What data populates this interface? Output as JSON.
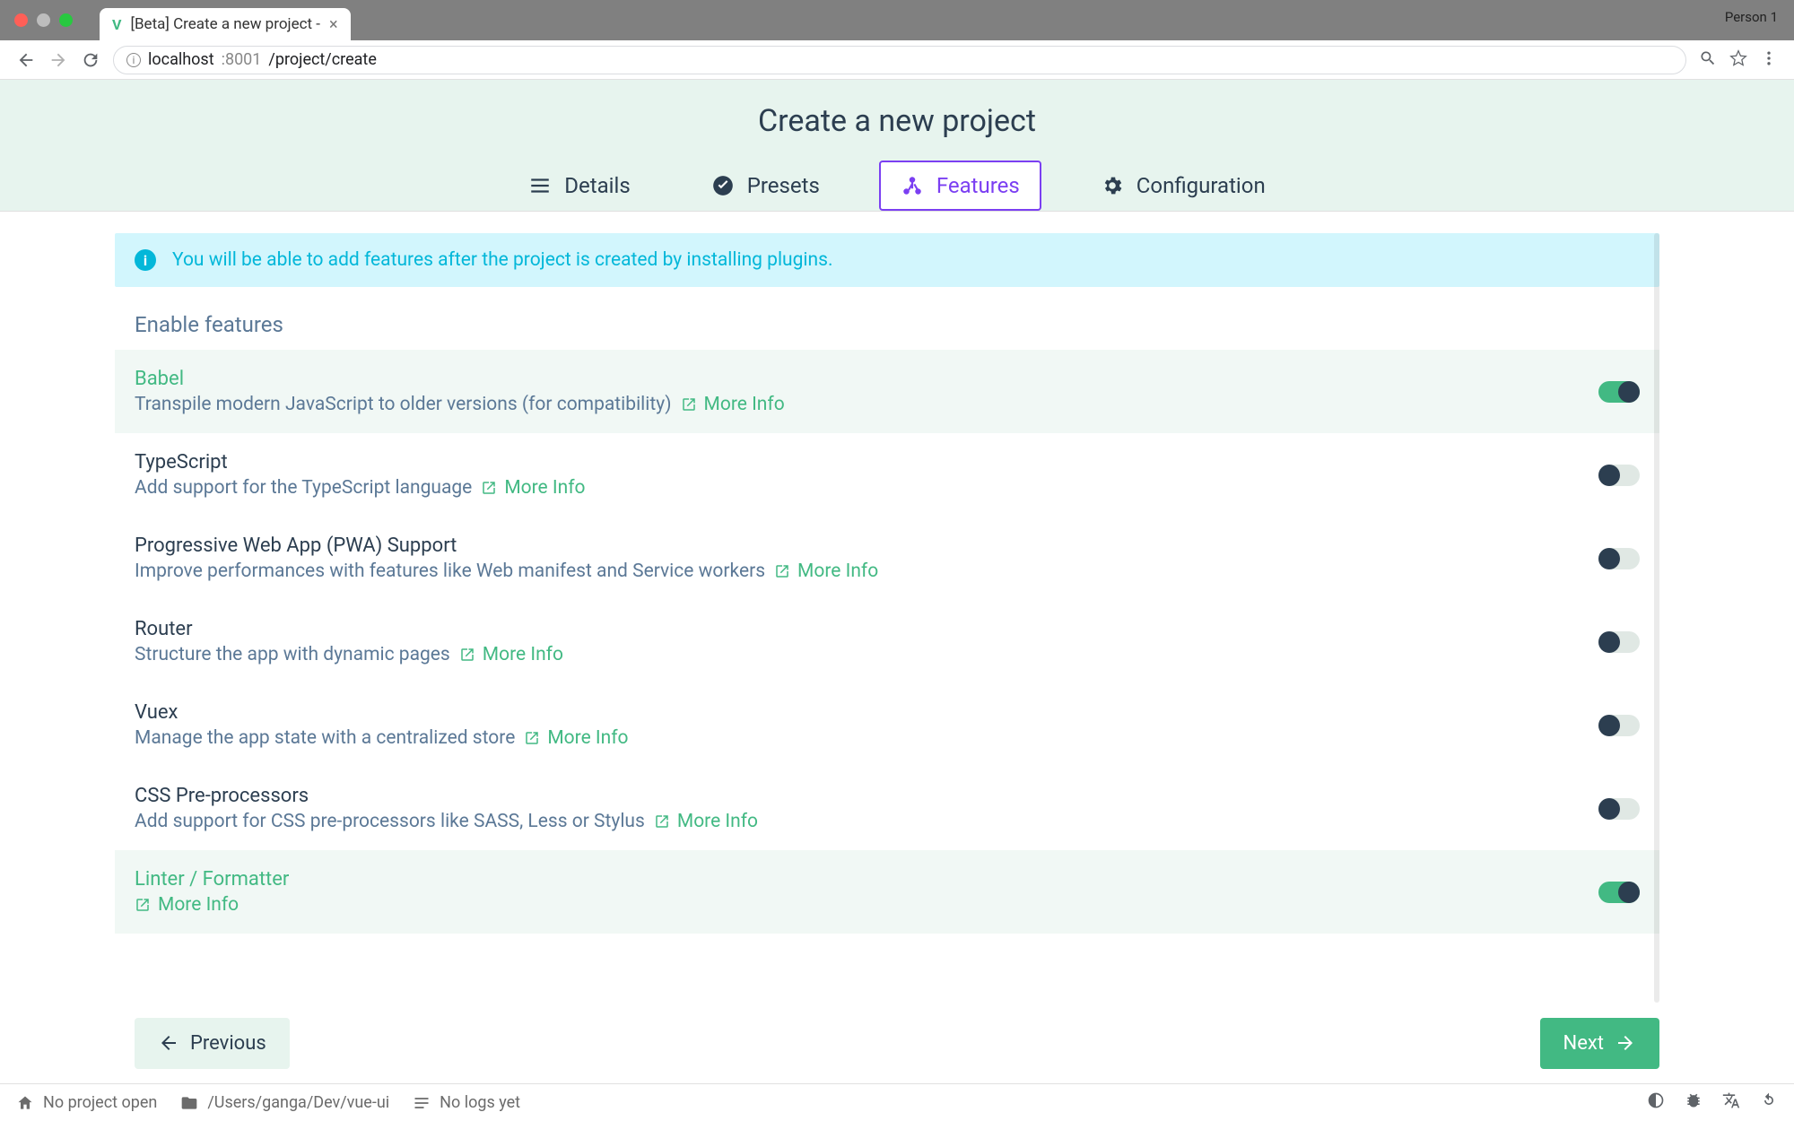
{
  "browser": {
    "tab_title": "[Beta] Create a new project -",
    "profile": "Person 1",
    "url_host": "localhost",
    "url_port": ":8001",
    "url_path": "/project/create"
  },
  "header": {
    "title": "Create a new project",
    "steps": [
      {
        "name": "Details"
      },
      {
        "name": "Presets"
      },
      {
        "name": "Features"
      },
      {
        "name": "Configuration"
      }
    ]
  },
  "banner": "You will be able to add features after the project is created by installing plugins.",
  "section_title": "Enable features",
  "more_info": "More Info",
  "features": [
    {
      "title": "Babel",
      "desc": "Transpile modern JavaScript to older versions (for compatibility)",
      "enabled": true
    },
    {
      "title": "TypeScript",
      "desc": "Add support for the TypeScript language",
      "enabled": false
    },
    {
      "title": "Progressive Web App (PWA) Support",
      "desc": "Improve performances with features like Web manifest and Service workers",
      "enabled": false
    },
    {
      "title": "Router",
      "desc": "Structure the app with dynamic pages",
      "enabled": false
    },
    {
      "title": "Vuex",
      "desc": "Manage the app state with a centralized store",
      "enabled": false
    },
    {
      "title": "CSS Pre-processors",
      "desc": "Add support for CSS pre-processors like SASS, Less or Stylus",
      "enabled": false
    },
    {
      "title": "Linter / Formatter",
      "desc": "",
      "enabled": true
    }
  ],
  "footer": {
    "prev": "Previous",
    "next": "Next"
  },
  "status": {
    "project": "No project open",
    "folder": "/Users/ganga/Dev/vue-ui",
    "logs": "No logs yet"
  }
}
